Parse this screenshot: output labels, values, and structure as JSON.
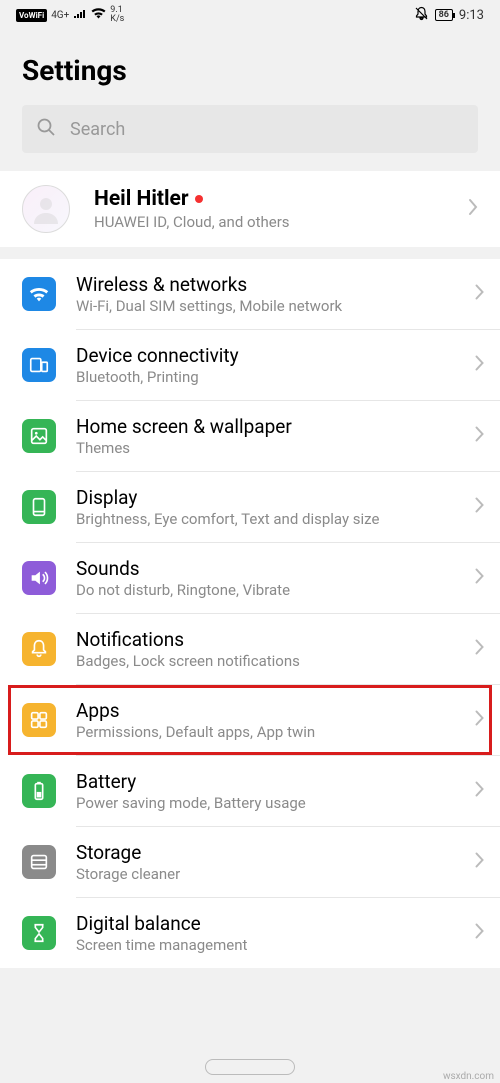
{
  "status": {
    "vowifi": "VoWiFi",
    "signal_gen": "4G+",
    "speed_num": "9.1",
    "speed_unit": "K/s",
    "battery": "86",
    "time": "9:13"
  },
  "page_title": "Settings",
  "search": {
    "placeholder": "Search"
  },
  "profile": {
    "name": "Heil Hitler",
    "subtitle": "HUAWEI ID, Cloud, and others"
  },
  "items": [
    {
      "title": "Wireless & networks",
      "subtitle": "Wi-Fi, Dual SIM settings, Mobile network",
      "icon": "wifi",
      "color": "ic-blue",
      "highlighted": false
    },
    {
      "title": "Device connectivity",
      "subtitle": "Bluetooth, Printing",
      "icon": "devices",
      "color": "ic-blue2",
      "highlighted": false
    },
    {
      "title": "Home screen & wallpaper",
      "subtitle": "Themes",
      "icon": "wallpaper",
      "color": "ic-green",
      "highlighted": false
    },
    {
      "title": "Display",
      "subtitle": "Brightness, Eye comfort, Text and display size",
      "icon": "display",
      "color": "ic-green2",
      "highlighted": false
    },
    {
      "title": "Sounds",
      "subtitle": "Do not disturb, Ringtone, Vibrate",
      "icon": "sound",
      "color": "ic-purple",
      "highlighted": false
    },
    {
      "title": "Notifications",
      "subtitle": "Badges, Lock screen notifications",
      "icon": "bell",
      "color": "ic-amber",
      "highlighted": false
    },
    {
      "title": "Apps",
      "subtitle": "Permissions, Default apps, App twin",
      "icon": "apps",
      "color": "ic-amber2",
      "highlighted": true
    },
    {
      "title": "Battery",
      "subtitle": "Power saving mode, Battery usage",
      "icon": "battery",
      "color": "ic-green3",
      "highlighted": false
    },
    {
      "title": "Storage",
      "subtitle": "Storage cleaner",
      "icon": "storage",
      "color": "ic-gray",
      "highlighted": false
    },
    {
      "title": "Digital balance",
      "subtitle": "Screen time management",
      "icon": "hourglass",
      "color": "ic-green4",
      "highlighted": false
    }
  ],
  "watermark": "wsxdn.com"
}
